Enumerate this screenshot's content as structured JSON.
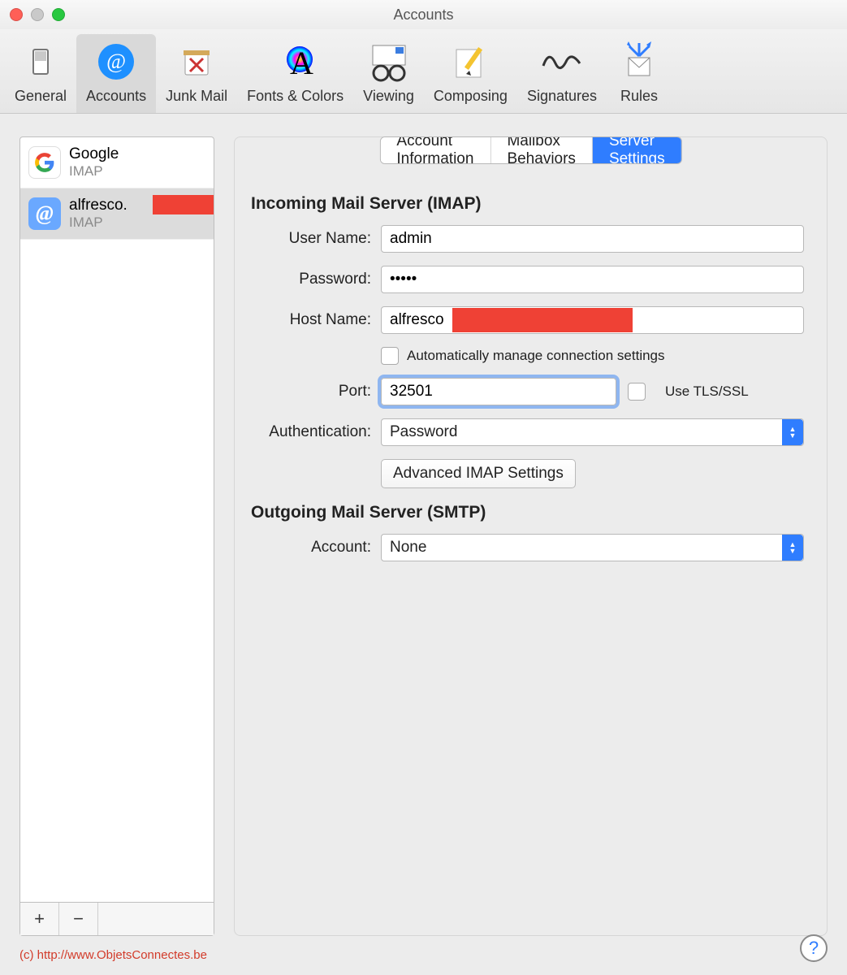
{
  "window": {
    "title": "Accounts"
  },
  "toolbar": {
    "items": [
      {
        "label": "General"
      },
      {
        "label": "Accounts"
      },
      {
        "label": "Junk Mail"
      },
      {
        "label": "Fonts & Colors"
      },
      {
        "label": "Viewing"
      },
      {
        "label": "Composing"
      },
      {
        "label": "Signatures"
      },
      {
        "label": "Rules"
      }
    ],
    "selected_index": 1
  },
  "sidebar": {
    "accounts": [
      {
        "name": "Google",
        "subtype": "IMAP"
      },
      {
        "name": "alfresco.",
        "subtype": "IMAP"
      }
    ],
    "selected_index": 1
  },
  "tabs": {
    "items": [
      {
        "label": "Account Information"
      },
      {
        "label": "Mailbox Behaviors"
      },
      {
        "label": "Server Settings"
      }
    ],
    "active_index": 2
  },
  "incoming": {
    "heading": "Incoming Mail Server (IMAP)",
    "user_name_label": "User Name:",
    "user_name_value": "admin",
    "password_label": "Password:",
    "password_value": "•••••",
    "host_name_label": "Host Name:",
    "host_name_value": "alfresco",
    "auto_manage_label": "Automatically manage connection settings",
    "auto_manage_checked": false,
    "port_label": "Port:",
    "port_value": "32501",
    "tls_label": "Use TLS/SSL",
    "tls_checked": false,
    "auth_label": "Authentication:",
    "auth_value": "Password",
    "advanced_button": "Advanced IMAP Settings"
  },
  "outgoing": {
    "heading": "Outgoing Mail Server (SMTP)",
    "account_label": "Account:",
    "account_value": "None"
  },
  "footer": {
    "note": "(c) http://www.ObjetsConnectes.be",
    "help": "?"
  }
}
